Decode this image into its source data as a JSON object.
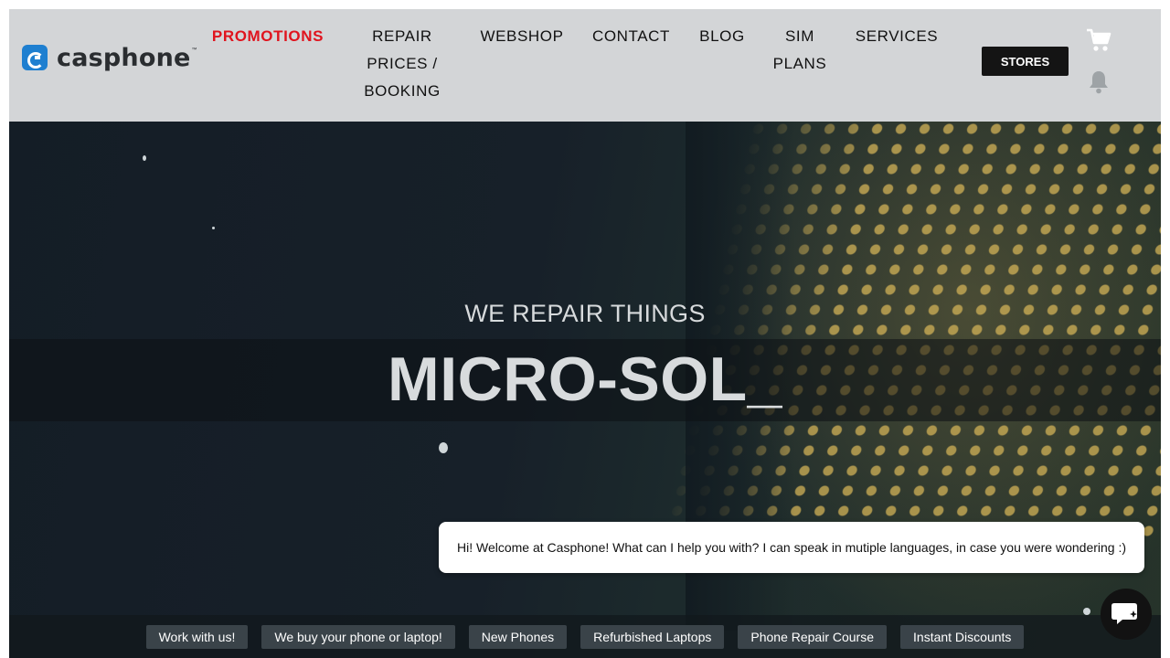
{
  "brand": {
    "name": "casphone",
    "trademark": "™",
    "mark_color": "#1e7fd0"
  },
  "nav": {
    "promotions": "PROMOTIONS",
    "repair_line1": "REPAIR",
    "repair_line2": "PRICES /",
    "repair_line3": "BOOKING",
    "webshop": "WEBSHOP",
    "contact": "CONTACT",
    "blog": "BLOG",
    "sim_line1": "SIM",
    "sim_line2": "PLANS",
    "services": "SERVICES"
  },
  "header": {
    "stores_label": "STORES",
    "cart_icon": "cart-icon",
    "bell_icon": "bell-icon",
    "promo_color": "#e0141e"
  },
  "hero": {
    "eyebrow": "WE REPAIR THINGS",
    "headline": "MICRO-SOL_"
  },
  "chat": {
    "message": "Hi! Welcome at Casphone! What can I help you with? I can speak in mutiple languages, in case you were wondering :)",
    "launcher_icon": "chat-icon"
  },
  "quick_links": [
    "Work with us!",
    "We buy your phone or laptop!",
    "New Phones",
    "Refurbished Laptops",
    "Phone Repair Course",
    "Instant Discounts"
  ]
}
